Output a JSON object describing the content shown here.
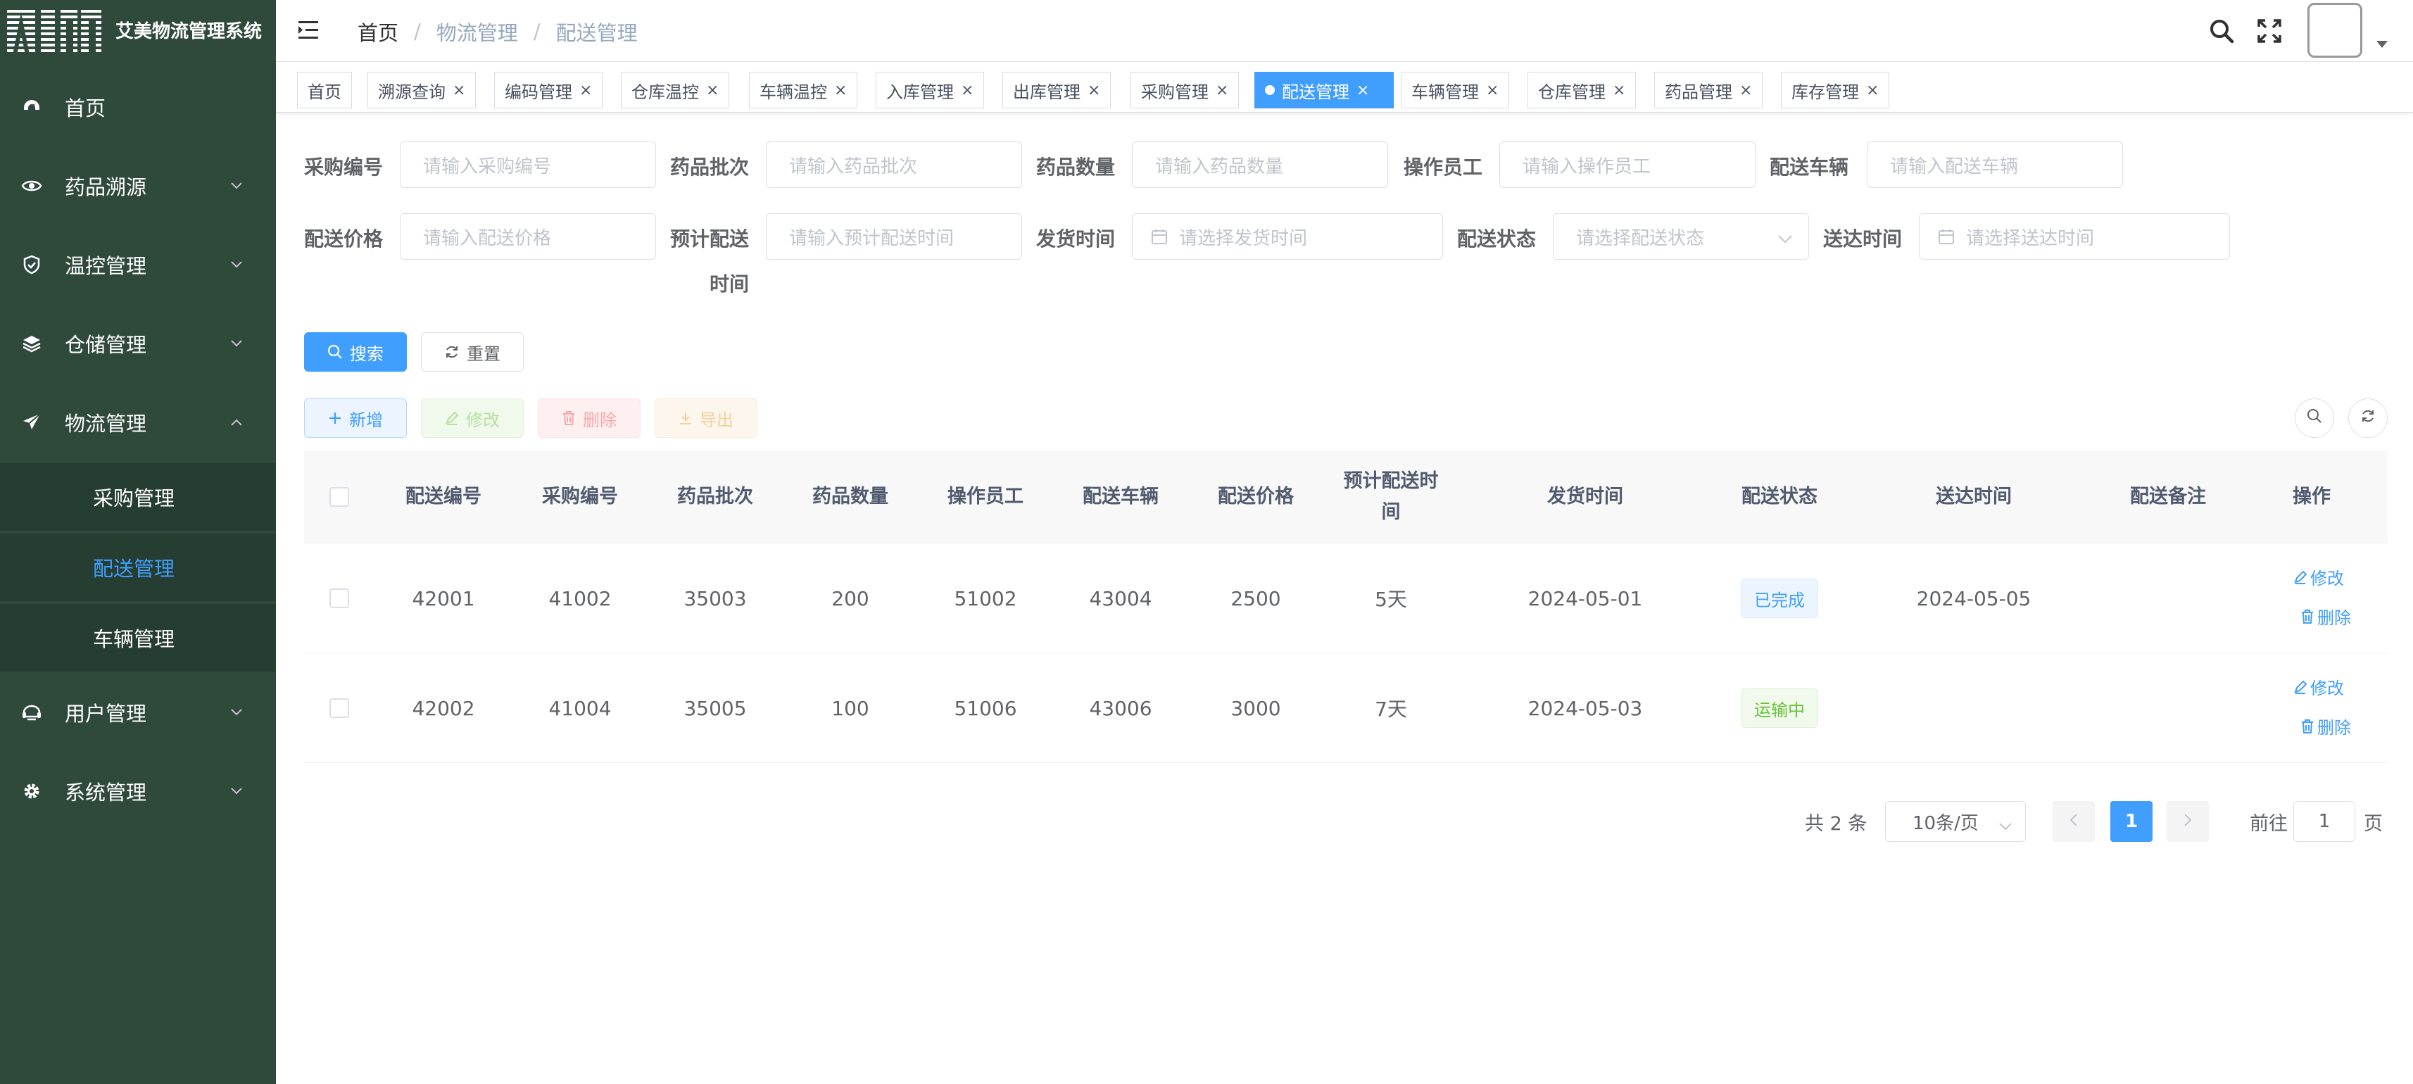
{
  "app": {
    "logo_text": "AIM",
    "title": "艾美物流管理系统"
  },
  "sidebar": {
    "items": [
      {
        "label": "首页",
        "icon": "dashboard-icon"
      },
      {
        "label": "药品溯源",
        "icon": "eye-icon"
      },
      {
        "label": "温控管理",
        "icon": "shield-check-icon"
      },
      {
        "label": "仓储管理",
        "icon": "layers-icon"
      },
      {
        "label": "物流管理",
        "icon": "send-icon"
      },
      {
        "label": "用户管理",
        "icon": "user-group-icon"
      },
      {
        "label": "系统管理",
        "icon": "settings-icon"
      }
    ],
    "sub_items": [
      {
        "label": "采购管理"
      },
      {
        "label": "配送管理"
      },
      {
        "label": "车辆管理"
      }
    ]
  },
  "breadcrumb": {
    "home": "首页",
    "sep": "/",
    "level1": "物流管理",
    "level2": "配送管理"
  },
  "tags": [
    {
      "label": "首页"
    },
    {
      "label": "溯源查询"
    },
    {
      "label": "编码管理"
    },
    {
      "label": "仓库温控"
    },
    {
      "label": "车辆温控"
    },
    {
      "label": "入库管理"
    },
    {
      "label": "出库管理"
    },
    {
      "label": "采购管理"
    },
    {
      "label": "配送管理"
    },
    {
      "label": "车辆管理"
    },
    {
      "label": "仓库管理"
    },
    {
      "label": "药品管理"
    },
    {
      "label": "库存管理"
    }
  ],
  "tag_close": "×",
  "search_form": {
    "purchase_no": {
      "label": "采购编号",
      "placeholder": "请输入采购编号"
    },
    "drug_batch": {
      "label": "药品批次",
      "placeholder": "请输入药品批次"
    },
    "drug_qty": {
      "label": "药品数量",
      "placeholder": "请输入药品数量"
    },
    "operator": {
      "label": "操作员工",
      "placeholder": "请输入操作员工"
    },
    "vehicle": {
      "label": "配送车辆",
      "placeholder": "请输入配送车辆"
    },
    "price": {
      "label": "配送价格",
      "placeholder": "请输入配送价格"
    },
    "est_time": {
      "label_line1": "预计配送",
      "label_line2": "时间",
      "placeholder": "请输入预计配送时间"
    },
    "ship_time": {
      "label": "发货时间",
      "placeholder": "请选择发货时间"
    },
    "status": {
      "label": "配送状态",
      "placeholder": "请选择配送状态"
    },
    "arrive_time": {
      "label": "送达时间",
      "placeholder": "请选择送达时间"
    },
    "search_btn": "搜索",
    "reset_btn": "重置"
  },
  "toolbar": {
    "add": "新增",
    "edit": "修改",
    "delete": "删除",
    "export": "导出"
  },
  "table": {
    "headers": [
      "配送编号",
      "采购编号",
      "药品批次",
      "药品数量",
      "操作员工",
      "配送车辆",
      "配送价格",
      "预计配送时间",
      "发货时间",
      "配送状态",
      "送达时间",
      "配送备注",
      "操作"
    ],
    "header_est_line1": "预计配送时",
    "header_est_line2": "间",
    "rows": [
      {
        "id": "42001",
        "purchase": "41002",
        "batch": "35003",
        "qty": "200",
        "operator": "51002",
        "vehicle": "43004",
        "price": "2500",
        "est": "5天",
        "ship": "2024-05-01",
        "status": "已完成",
        "arrive": "2024-05-05",
        "remark": "",
        "edit": "修改",
        "delete": "删除"
      },
      {
        "id": "42002",
        "purchase": "41004",
        "batch": "35005",
        "qty": "100",
        "operator": "51006",
        "vehicle": "43006",
        "price": "3000",
        "est": "7天",
        "ship": "2024-05-03",
        "status": "运输中",
        "arrive": "",
        "remark": "",
        "edit": "修改",
        "delete": "删除"
      }
    ]
  },
  "pagination": {
    "total": "共 2 条",
    "page_size": "10条/页",
    "current": "1",
    "goto_label": "前往",
    "goto_value": "1",
    "page_label": "页"
  },
  "colors": {
    "sidebar_bg": "#2f4a3a",
    "primary": "#409eff",
    "success": "#67c23a"
  }
}
